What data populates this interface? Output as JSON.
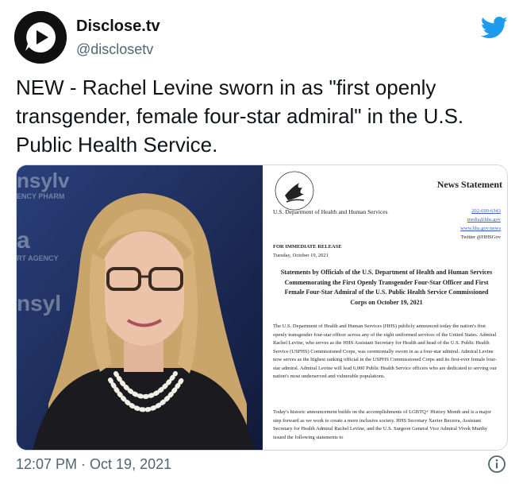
{
  "author": {
    "display_name": "Disclose.tv",
    "handle": "@disclosetv",
    "avatar_icon": "play-logo-icon"
  },
  "platform_icon": "twitter-bird-icon",
  "tweet": {
    "text": "NEW - Rachel Levine sworn in as \"first openly transgender, female four-star admiral\" in the U.S. Public Health Service."
  },
  "media": {
    "photo_bg_words": [
      "nsylv",
      "ENCY PHARM",
      "a",
      "RT AGENCY",
      "nsyl"
    ],
    "document": {
      "news_label": "News Statement",
      "department": "U.S. Department of Health and Human Services",
      "contact": [
        "202-690-6343",
        "media@hhs.gov",
        "www.hhs.gov/news",
        "Twitter @HHSGov"
      ],
      "release_label": "FOR IMMEDIATE RELEASE",
      "date": "Tuesday, October 19, 2021",
      "headline": "Statements by Officials of the U.S. Department of Health and Human Services Commemorating the First Openly Transgender Four-Star Officer and First Female Four-Star Admiral of the U.S. Public Health Service Commissioned Corps on October 19, 2021",
      "paragraph_1": "The U.S. Department of Health and Human Services (HHS) publicly announced today the nation's first openly transgender four-star officer across any of the eight uniformed services of the United States. Admiral Rachel Levine, who serves as the HHS Assistant Secretary for Health and head of the U.S. Public Health Service (USPHS) Commissioned Corps, was ceremonially sworn in as a four-star admiral. Admiral Levine now serves as the highest ranking official in the USPHS Commissioned Corps and its first-ever female four-star admiral. Admiral Levine will lead 6,000 Public Health Service officers who are dedicated to serving our nation's most underserved and vulnerable populations.",
      "paragraph_2": "Today's historic announcement builds on the accomplishments of LGBTQ+ History Month and is a major step forward as we work to create a more inclusive society. HHS Secretary Xavier Becerra, Assistant Secretary for Health Admiral Rachel Levine, and the U.S. Surgeon General Vice Admiral Vivek Murthy issued the following statements to"
    }
  },
  "timestamp": "12:07 PM · Oct 19, 2021",
  "info_icon": "info-icon",
  "colors": {
    "twitter_blue": "#1d9bf0",
    "text_primary": "#0f1419",
    "text_secondary": "#536471",
    "border": "#cfd9de"
  }
}
